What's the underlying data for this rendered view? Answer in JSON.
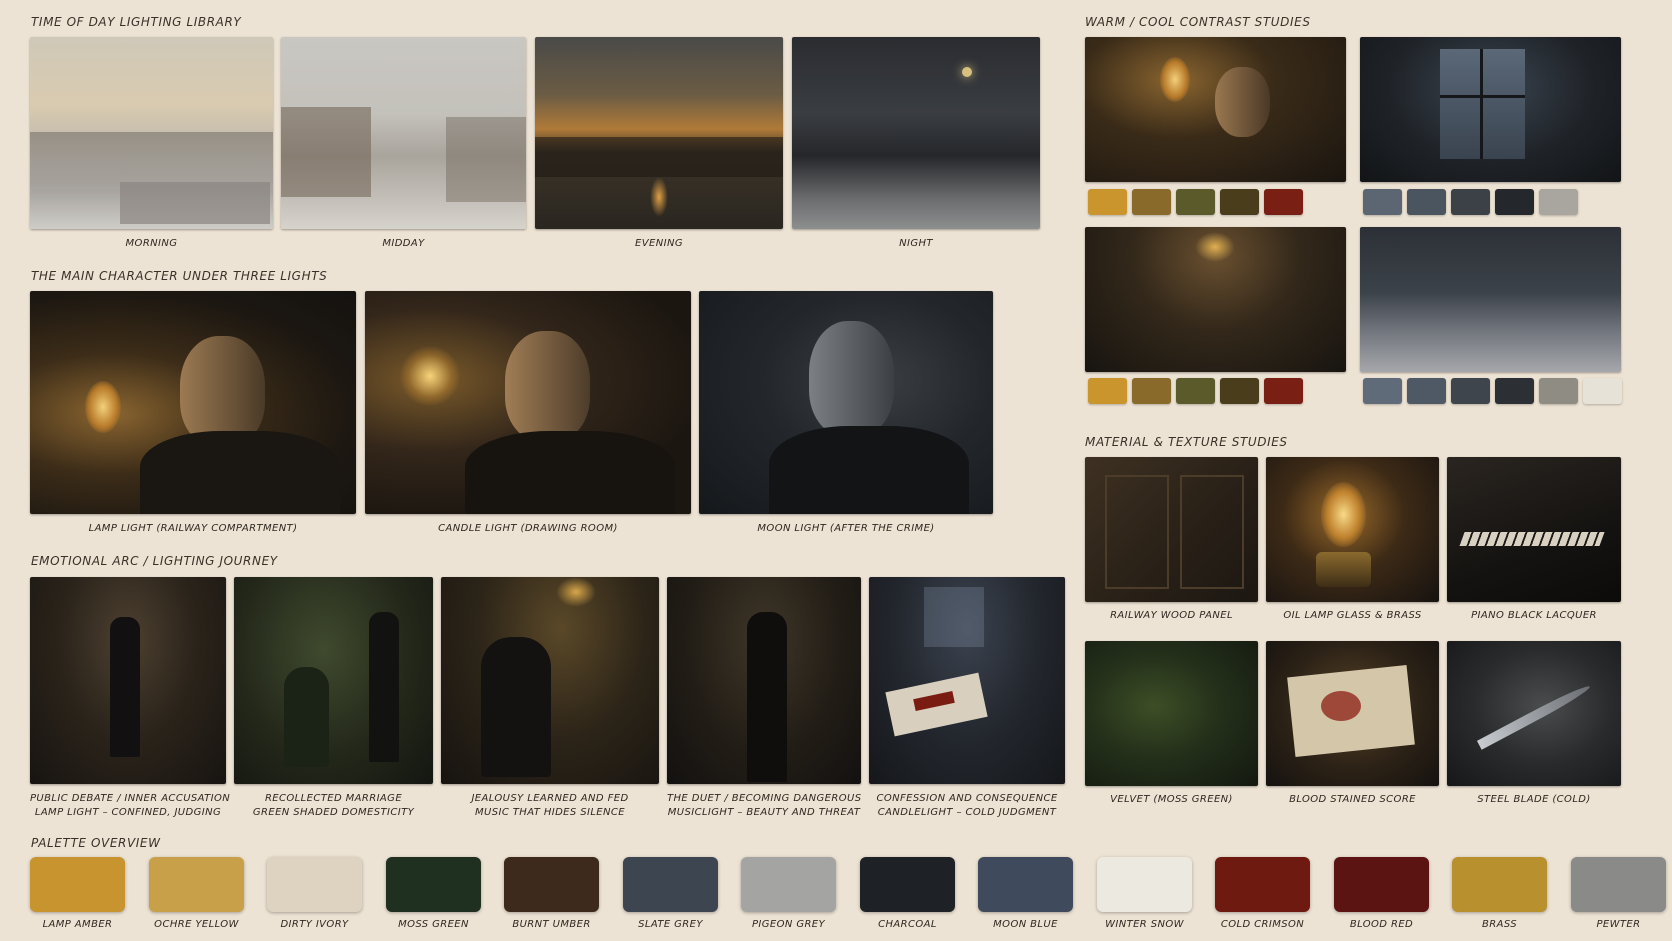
{
  "sections": {
    "time_of_day": "TIME OF DAY LIGHTING LIBRARY",
    "main_character": "THE MAIN CHARACTER UNDER THREE LIGHTS",
    "emotional_arc": "EMOTIONAL ARC / LIGHTING JOURNEY",
    "palette": "PALETTE OVERVIEW",
    "warm_cool": "WARM / COOL CONTRAST STUDIES",
    "material": "MATERIAL & TEXTURE STUDIES"
  },
  "time_of_day": [
    {
      "label": "MORNING"
    },
    {
      "label": "MIDDAY"
    },
    {
      "label": "EVENING"
    },
    {
      "label": "NIGHT"
    }
  ],
  "character": [
    {
      "label": "LAMP LIGHT (RAILWAY COMPARTMENT)"
    },
    {
      "label": "CANDLE LIGHT (DRAWING ROOM)"
    },
    {
      "label": "MOON LIGHT (AFTER THE CRIME)"
    }
  ],
  "arc": [
    {
      "line1": "PUBLIC DEBATE / INNER ACCUSATION",
      "line2": "LAMP LIGHT – CONFINED, JUDGING"
    },
    {
      "line1": "RECOLLECTED MARRIAGE",
      "line2": "GREEN SHADED DOMESTICITY"
    },
    {
      "line1": "JEALOUSY LEARNED AND FED",
      "line2": "MUSIC THAT HIDES SILENCE"
    },
    {
      "line1": "THE DUET / BECOMING DANGEROUS",
      "line2": "MUSICLIGHT – BEAUTY AND THREAT"
    },
    {
      "line1": "CONFESSION AND CONSEQUENCE",
      "line2": "CANDLELIGHT – COLD JUDGMENT"
    }
  ],
  "warm_swatches": [
    "#c9952c",
    "#8a6a2a",
    "#5b5a2a",
    "#4a3d1c",
    "#7a1f14"
  ],
  "cool_swatches_top": [
    "#5b6672",
    "#4b5560",
    "#3c4148",
    "#24272b",
    "#a9a69f"
  ],
  "cool_swatches_bottom": [
    "#5f6b78",
    "#4e5965",
    "#3e454d",
    "#2c2f33",
    "#8f8c84",
    "#e6e2d8"
  ],
  "materials": [
    {
      "label": "RAILWAY WOOD PANEL"
    },
    {
      "label": "OIL LAMP GLASS & BRASS"
    },
    {
      "label": "PIANO BLACK LACQUER"
    },
    {
      "label": "VELVET (MOSS GREEN)"
    },
    {
      "label": "BLOOD STAINED SCORE"
    },
    {
      "label": "STEEL BLADE (COLD)"
    }
  ],
  "palette": [
    {
      "name": "LAMP AMBER",
      "color": "#c7942f"
    },
    {
      "name": "OCHRE YELLOW",
      "color": "#c9a04a"
    },
    {
      "name": "DIRTY IVORY",
      "color": "#ddd3c0"
    },
    {
      "name": "MOSS GREEN",
      "color": "#1f3020"
    },
    {
      "name": "BURNT UMBER",
      "color": "#3e2a1c"
    },
    {
      "name": "SLATE GREY",
      "color": "#3d4550"
    },
    {
      "name": "PIGEON GREY",
      "color": "#a4a5a3"
    },
    {
      "name": "CHARCOAL",
      "color": "#1e2125"
    },
    {
      "name": "MOON BLUE",
      "color": "#3f4a5c"
    },
    {
      "name": "WINTER SNOW",
      "color": "#ece9e1"
    },
    {
      "name": "COLD CRIMSON",
      "color": "#6e1a10"
    },
    {
      "name": "BLOOD RED",
      "color": "#5c1412"
    },
    {
      "name": "BRASS",
      "color": "#b8902e"
    },
    {
      "name": "PEWTER",
      "color": "#8a8a88"
    }
  ]
}
